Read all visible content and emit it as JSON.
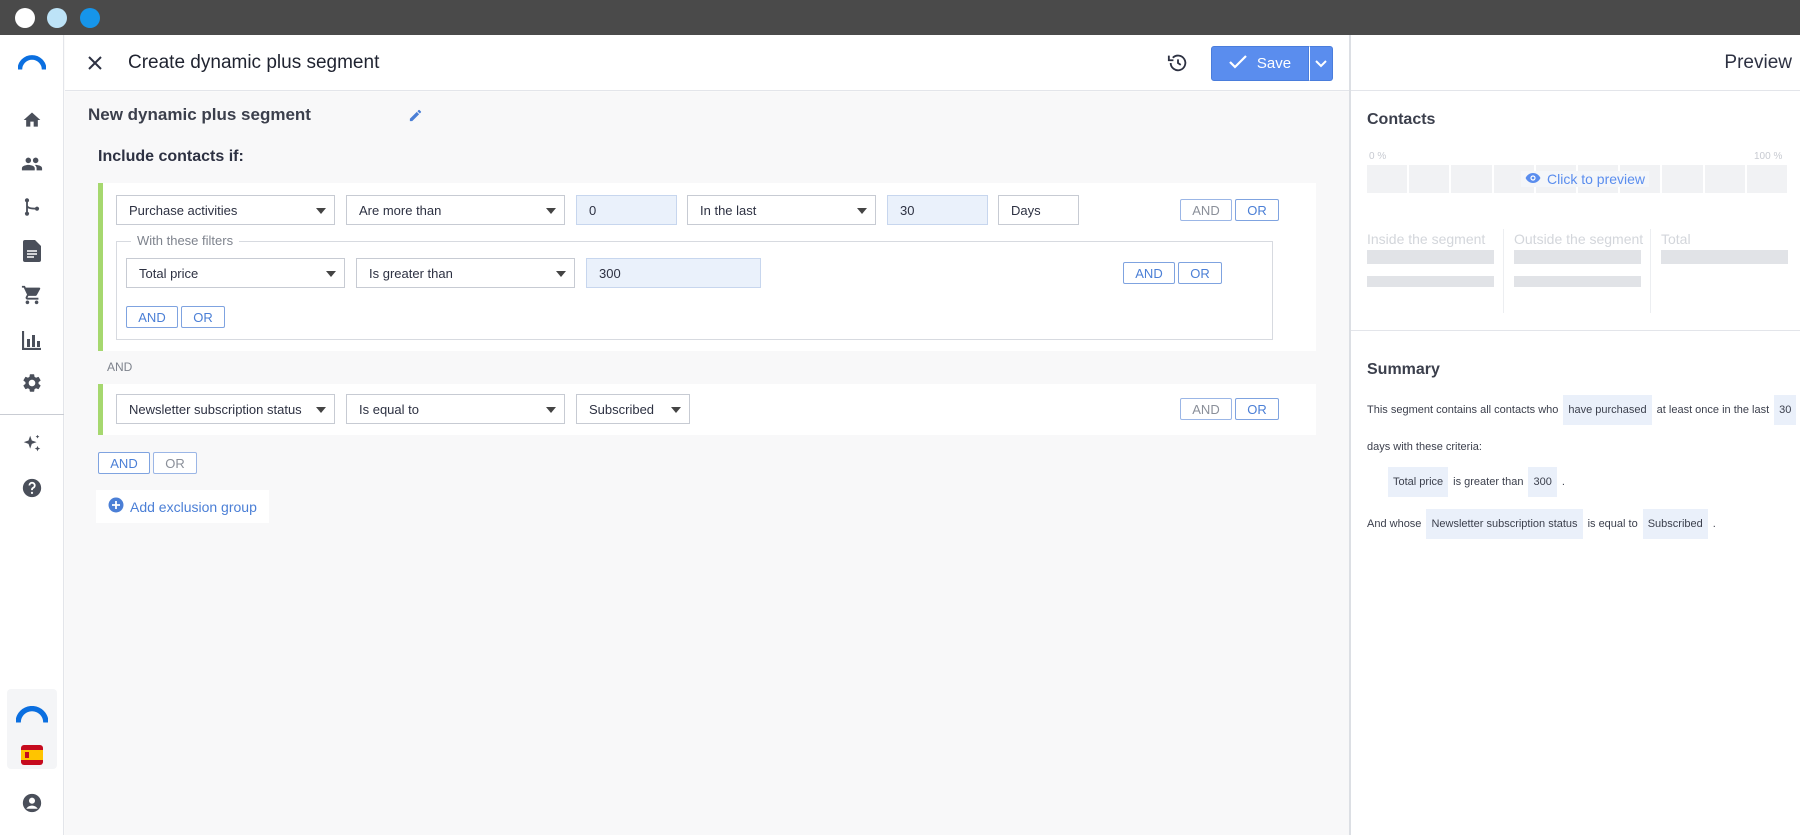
{
  "window": {
    "title": "Create dynamic plus segment"
  },
  "topbar": {
    "save_label": "Save"
  },
  "segment": {
    "name": "New dynamic plus segment"
  },
  "include_label": "Include contacts if:",
  "group1": {
    "field": "Purchase activities",
    "operator": "Are more than",
    "value": "0",
    "period": "In the last",
    "period_value": "30",
    "period_unit": "Days",
    "and_label": "AND",
    "or_label": "OR",
    "filters": {
      "legend": "With these filters",
      "field": "Total price",
      "operator": "Is greater than",
      "value": "300",
      "and_label": "AND",
      "or_label": "OR",
      "add_and": "AND",
      "add_or": "OR"
    }
  },
  "separator": "AND",
  "group2": {
    "field": "Newsletter subscription status",
    "operator": "Is equal to",
    "value": "Subscribed",
    "and_label": "AND",
    "or_label": "OR"
  },
  "bottom": {
    "and_label": "AND",
    "or_label": "OR",
    "add_exclusion": "Add exclusion group"
  },
  "preview": {
    "title": "Preview",
    "contacts_title": "Contacts",
    "pct_min": "0 %",
    "pct_max": "100 %",
    "click_to_preview": "Click to preview",
    "col_inside": "Inside the segment",
    "col_outside": "Outside the segment",
    "col_total": "Total"
  },
  "summary": {
    "title": "Summary",
    "line1_a": "This segment contains all contacts who",
    "line1_chip1": "have purchased",
    "line1_b": "at least once in the last",
    "line1_chip2": "30",
    "line2": "days with these criteria:",
    "line3_chip1": "Total price",
    "line3_a": "is greater than",
    "line3_chip2": "300",
    "line3_end": ".",
    "line4_a": "And whose",
    "line4_chip1": "Newsletter subscription status",
    "line4_b": "is equal to",
    "line4_chip2": "Subscribed",
    "line4_end": "."
  },
  "colors": {
    "accent": "#5a8dee",
    "group_border": "#a6d86f",
    "titlebar": "#4a4a4a"
  },
  "icons": [
    "logo-icon",
    "home-icon",
    "contacts-icon",
    "automation-icon",
    "document-icon",
    "cart-icon",
    "reports-icon",
    "settings-icon",
    "sparkle-icon",
    "help-icon",
    "spain-flag-icon",
    "user-icon",
    "close-icon",
    "history-icon",
    "check-icon",
    "chevron-down-icon",
    "pencil-icon",
    "plus-circle-icon",
    "eye-icon"
  ]
}
